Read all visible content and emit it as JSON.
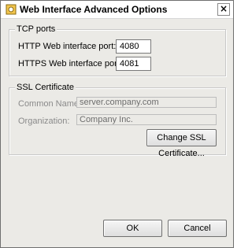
{
  "window": {
    "title": "Web Interface Advanced Options",
    "close_symbol": "×"
  },
  "tcp_group": {
    "label": "TCP ports",
    "http_label": "HTTP Web interface port:",
    "http_value": "4080",
    "https_label": "HTTPS Web interface port:",
    "https_value": "4081"
  },
  "ssl_group": {
    "label": "SSL Certificate",
    "common_name_label": "Common Name:",
    "common_name_value": "server.company.com",
    "organization_label": "Organization:",
    "organization_value": "Company Inc.",
    "change_button": "Change SSL Certificate..."
  },
  "buttons": {
    "ok": "OK",
    "cancel": "Cancel"
  }
}
